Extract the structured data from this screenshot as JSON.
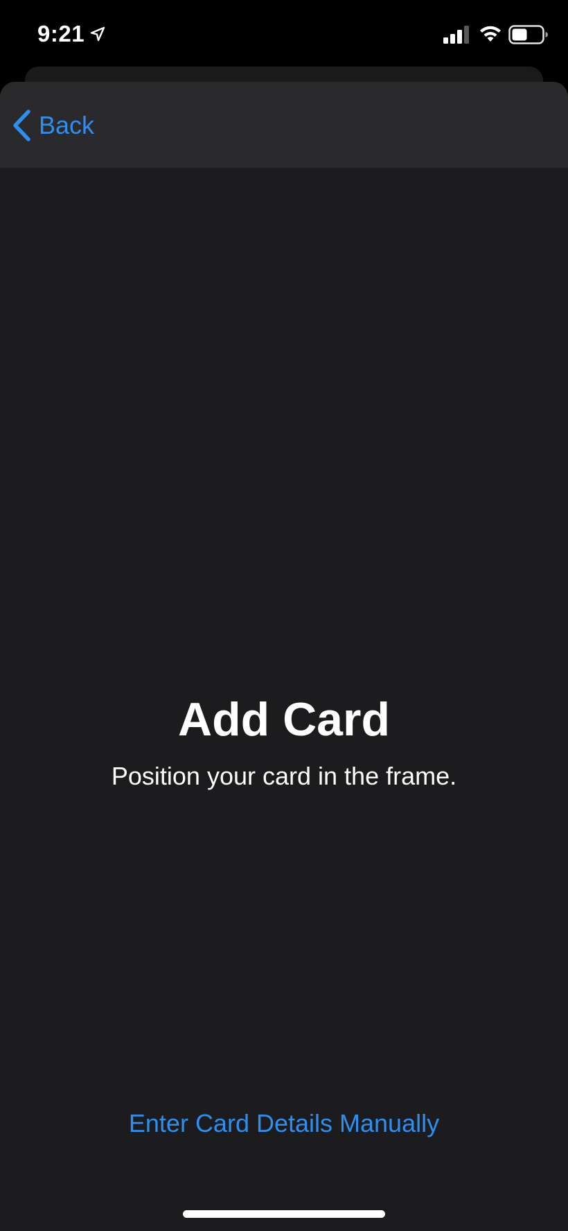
{
  "status_bar": {
    "time": "9:21",
    "icons": [
      "location-arrow-icon",
      "signal-icon",
      "wifi-icon",
      "battery-icon"
    ]
  },
  "nav": {
    "back_label": "Back",
    "back_icon": "chevron-left-icon"
  },
  "main": {
    "title": "Add Card",
    "subtitle": "Position your card in the frame."
  },
  "footer": {
    "manual_entry_label": "Enter Card Details Manually"
  },
  "colors": {
    "accent": "#2f8ff0",
    "background": "#1c1c1e",
    "nav_background": "#2a2a2c",
    "text": "#ffffff"
  }
}
